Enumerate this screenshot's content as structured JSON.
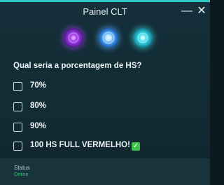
{
  "window": {
    "title": "Painel CLT",
    "minimize_symbol": "—",
    "close_symbol": "✕"
  },
  "avatars": [
    {
      "name": "purple-emblem-icon",
      "color": "#8a2fd6"
    },
    {
      "name": "blue-emblem-icon",
      "color": "#2b7fd9"
    },
    {
      "name": "cyan-emblem-icon",
      "color": "#36d7e6"
    }
  ],
  "question": "Qual seria a porcentagem de HS?",
  "options": [
    {
      "label": "70%",
      "checked": false
    },
    {
      "label": "80%",
      "checked": false
    },
    {
      "label": "90%",
      "checked": false
    },
    {
      "label": "100 HS FULL VERMELHO!",
      "suffix_icon": "✓",
      "checked": false
    }
  ],
  "status": {
    "label": "Status",
    "value": "Online",
    "value_color": "#2fd07a"
  },
  "colors": {
    "accent": "#2ec9c1",
    "panel_background": "#15303a"
  }
}
